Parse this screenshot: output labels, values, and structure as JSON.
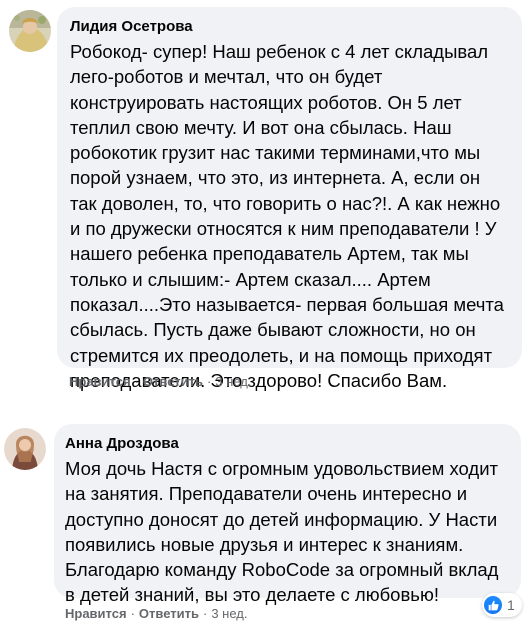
{
  "comments": [
    {
      "author": "Лидия Осетрова",
      "text": "Робокод- супер! Наш ребенок с 4 лет складывал лего-роботов и мечтал, что он будет конструировать настоящих роботов. Он 5 лет теплил свою мечту. И вот она сбылась. Наш робокотик грузит нас такими терминами,что мы порой узнаем, что это, из интернета. А, если он так доволен, то, что говорить о нас?!. А как нежно и по дружески относятся к ним преподаватели ! У нашего ребенка преподаватель Артем, так мы только и слышим:- Артем сказал.... Артем показал....Это называется- первая большая мечта сбылась. Пусть даже бывают сложности, но он стремится их преодолеть, и на помощь приходят преподаватели. Это здорово! Спасибо Вам.",
      "like_label": "Нравится",
      "reply_label": "Ответить",
      "time": "3 нед."
    },
    {
      "author": "Анна Дроздова",
      "text": "Моя дочь Настя с огромным удовольствием ходит на занятия. Преподаватели очень интересно и доступно доносят до детей информацию. У Насти появились новые друзья и интерес к знаниям. Благодарю команду RoboCode за огромный вклад в детей знаний, вы это делаете с любовью!",
      "like_label": "Нравится",
      "reply_label": "Ответить",
      "time": "3 нед.",
      "reaction_count": "1"
    }
  ],
  "separator": "·",
  "colors": {
    "bubble": "#f0f2f5",
    "meta": "#65676b",
    "like_blue": "#1877f2"
  },
  "icons": {
    "reaction": "thumbs-up-icon"
  }
}
